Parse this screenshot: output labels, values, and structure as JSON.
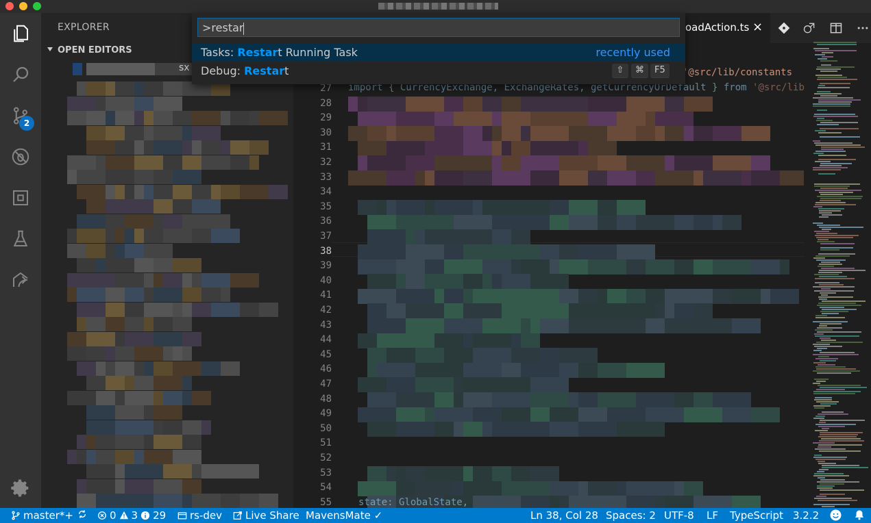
{
  "app": {
    "palette": {
      "input_value": ">restar",
      "items": [
        {
          "prefix": "Tasks: ",
          "highlight": "Restar",
          "suffix": "t Running Task",
          "right": "recently used",
          "selected": true
        },
        {
          "prefix": "Debug: ",
          "highlight": "Restar",
          "suffix": "t",
          "keys": [
            "⇧",
            "⌘",
            "F5"
          ],
          "selected": false
        }
      ]
    },
    "sidebar": {
      "title": "EXPLORER",
      "section": "OPEN EDITORS",
      "file_ext": "sx"
    },
    "activity": {
      "scm_badge": "2"
    },
    "editor": {
      "tab_label": "oadAction.ts",
      "tab_close": "×",
      "line_numbers": [
        "27",
        "28",
        "29",
        "30",
        "31",
        "32",
        "33",
        "34",
        "35",
        "36",
        "37",
        "38",
        "39",
        "40",
        "41",
        "42",
        "43",
        "44",
        "45",
        "46",
        "47",
        "48",
        "49",
        "50",
        "51",
        "52",
        "53",
        "54",
        "55"
      ],
      "current_line": "38",
      "code_top_right": "m '@src/lib/constants",
      "code_line27_a": "import { CurrencyExchange, ExchangeRates, getCurrencyOrDefault } from",
      "code_line27_b": "'@src/lib",
      "code_line55": "state: GlobalState,"
    },
    "statusbar": {
      "branch": "master*+",
      "errors": "0",
      "warnings": "3",
      "infos": "29",
      "workspace": "rs-dev",
      "live_share": "Live Share",
      "mavensmate": "MavensMate ✓",
      "cursor": "Ln 38, Col 28",
      "spaces": "Spaces: 2",
      "encoding": "UTF-8",
      "eol": "LF",
      "language": "TypeScript",
      "version": "3.2.2"
    },
    "colors": {
      "statusbar": "#007acc",
      "activitybar": "#333333",
      "sidebar": "#252526",
      "editor": "#1e1e1e",
      "highlight": "#0097fb"
    }
  }
}
